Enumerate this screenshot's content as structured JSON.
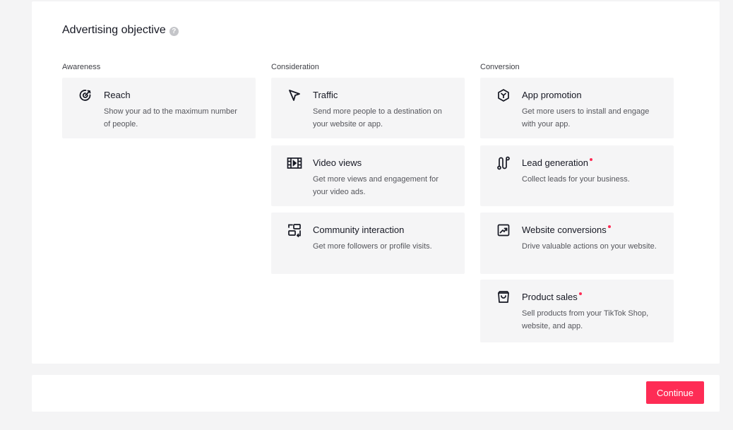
{
  "header": {
    "title": "Advertising objective",
    "help_glyph": "?"
  },
  "columns": [
    {
      "label": "Awareness",
      "cards": [
        {
          "icon": "target-icon",
          "title": "Reach",
          "desc": "Show your ad to the maximum number of people."
        }
      ]
    },
    {
      "label": "Consideration",
      "cards": [
        {
          "icon": "cursor-arrow-icon",
          "title": "Traffic",
          "desc": "Send more people to a destination on your website or app."
        },
        {
          "icon": "film-icon",
          "title": "Video views",
          "desc": "Get more views and engagement for your video ads."
        },
        {
          "icon": "community-icon",
          "title": "Community interaction",
          "desc": "Get more followers or profile visits."
        }
      ]
    },
    {
      "label": "Conversion",
      "cards": [
        {
          "icon": "cube-icon",
          "title": "App promotion",
          "desc": "Get more users to install and engage with your app."
        },
        {
          "icon": "lead-route-icon",
          "title": "Lead generation",
          "desc": "Collect leads for your business.",
          "new_dot": true
        },
        {
          "icon": "trend-chart-icon",
          "title": "Website conversions",
          "desc": "Drive valuable actions on your website.",
          "new_dot": true
        },
        {
          "icon": "shopping-bag-icon",
          "title": "Product sales",
          "desc": "Sell products from your TikTok Shop, website, and app.",
          "new_dot": true
        }
      ]
    }
  ],
  "footer": {
    "continue_label": "Continue"
  },
  "colors": {
    "accent": "#fe2c55",
    "card_bg": "#f5f5f6",
    "page_bg": "#f4f4f5",
    "new_dot": "#fe2c55"
  }
}
